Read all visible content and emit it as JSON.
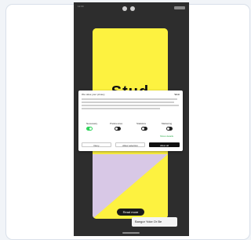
{
  "statusbar": {
    "time": "12:00"
  },
  "story": {
    "heading": "Stud",
    "cta": "Read more",
    "bottom_chip": "Bangor Yoke Or Be"
  },
  "consent": {
    "title": "We value your privacy",
    "logo": "Vizzi",
    "categories": [
      {
        "label": "Necessary",
        "on": true
      },
      {
        "label": "Preferences",
        "on": false
      },
      {
        "label": "Statistics",
        "on": false
      },
      {
        "label": "Marketing",
        "on": false
      }
    ],
    "more_link": "Show details",
    "buttons": {
      "deny": "Deny",
      "allow_selection": "Allow selection",
      "allow_all": "Allow all"
    }
  },
  "colors": {
    "story_yellow": "#fdf240",
    "story_lilac": "#d8c8e6",
    "toggle_on": "#2fd45a"
  }
}
